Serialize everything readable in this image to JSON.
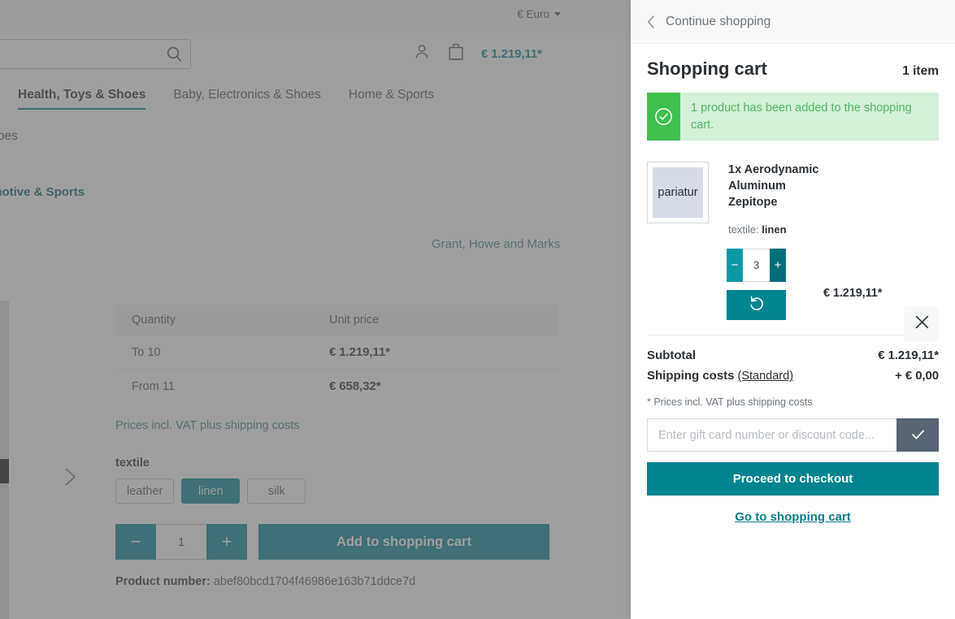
{
  "background": {
    "topbar": {
      "currency_label": "€ Euro"
    },
    "search": {
      "placeholder": "",
      "value": "",
      "icon": "search-icon"
    },
    "header": {
      "account_icon": "user-icon",
      "cart_icon": "shopping-bag-icon",
      "cart_total": "€ 1.219,11*"
    },
    "nav": [
      {
        "label": "Health, Toys & Shoes",
        "active": true
      },
      {
        "label": "Baby, Electronics & Shoes",
        "active": false
      },
      {
        "label": "Home & Sports",
        "active": false
      }
    ],
    "subnav_label": "rden & Shoes",
    "breadcrumb_category": "mputers, Automotive & Sports",
    "manufacturer": "Grant, Howe and Marks",
    "price_table": {
      "headers": [
        "Quantity",
        "Unit price"
      ],
      "rows": [
        {
          "quantity": "To 10",
          "unit_price": "€ 1.219,11*"
        },
        {
          "quantity": "From 11",
          "unit_price": "€ 658,32*"
        }
      ]
    },
    "vat_note": "Prices incl. VAT plus shipping costs",
    "variant": {
      "label": "textile",
      "options": [
        {
          "label": "leather",
          "selected": false
        },
        {
          "label": "linen",
          "selected": true
        },
        {
          "label": "silk",
          "selected": false
        }
      ]
    },
    "buy": {
      "minus_label": "−",
      "quantity": "1",
      "plus_label": "+",
      "add_to_cart_label": "Add to shopping cart"
    },
    "product_number_label": "Product number:",
    "product_number_value": "abef80bcd1704f46986e163b71ddce7d",
    "gallery_next_icon": "chevron-right-icon"
  },
  "cart": {
    "back_link": "Continue shopping",
    "back_icon": "chevron-left-icon",
    "title": "Shopping cart",
    "count": "1 item",
    "alert": {
      "icon": "check-circle-icon",
      "message": "1 product has been added to the shopping cart."
    },
    "item": {
      "thumbnail_text": "pariatur",
      "name": "1x Aerodynamic Aluminum Zepitope",
      "option_label": "textile:",
      "option_value": "linen",
      "quantity": "3",
      "minus_label": "−",
      "plus_label": "+",
      "undo_icon": "undo-icon",
      "price": "€ 1.219,11*",
      "remove_icon": "close-icon"
    },
    "summary": {
      "subtotal_label": "Subtotal",
      "subtotal_value": "€ 1.219,11*",
      "shipping_label": "Shipping costs",
      "shipping_method": "(Standard)",
      "shipping_value": "+ € 0,00"
    },
    "vat_note": "* Prices incl. VAT plus shipping costs",
    "promo": {
      "placeholder": "Enter gift card number or discount code...",
      "value": "",
      "submit_icon": "check-icon"
    },
    "checkout_label": "Proceed to checkout",
    "go_to_cart_label": "Go to shopping cart"
  },
  "colors": {
    "brand_teal": "#008490",
    "dark_teal": "#00707c",
    "light_teal": "#0b9aa5",
    "success_green": "#3ec04f",
    "success_bg": "#d4f0d9",
    "slate": "#586471"
  }
}
